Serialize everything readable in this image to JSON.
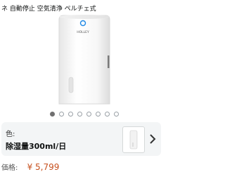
{
  "product": {
    "title_line1": "ネ 自動停止 空気清浄 ペルチェ式",
    "brand_on_device": "HOLLEY"
  },
  "carousel": {
    "dot_count": 8,
    "active_index": 0
  },
  "variant": {
    "label": "色:",
    "value": "除湿量300ml/日"
  },
  "price": {
    "label": "価格:",
    "value": "¥ 5,799"
  },
  "colors": {
    "accent_price": "#c7511f",
    "card_bg": "#f3f5f6",
    "indicator_blue": "#1e88e5"
  }
}
